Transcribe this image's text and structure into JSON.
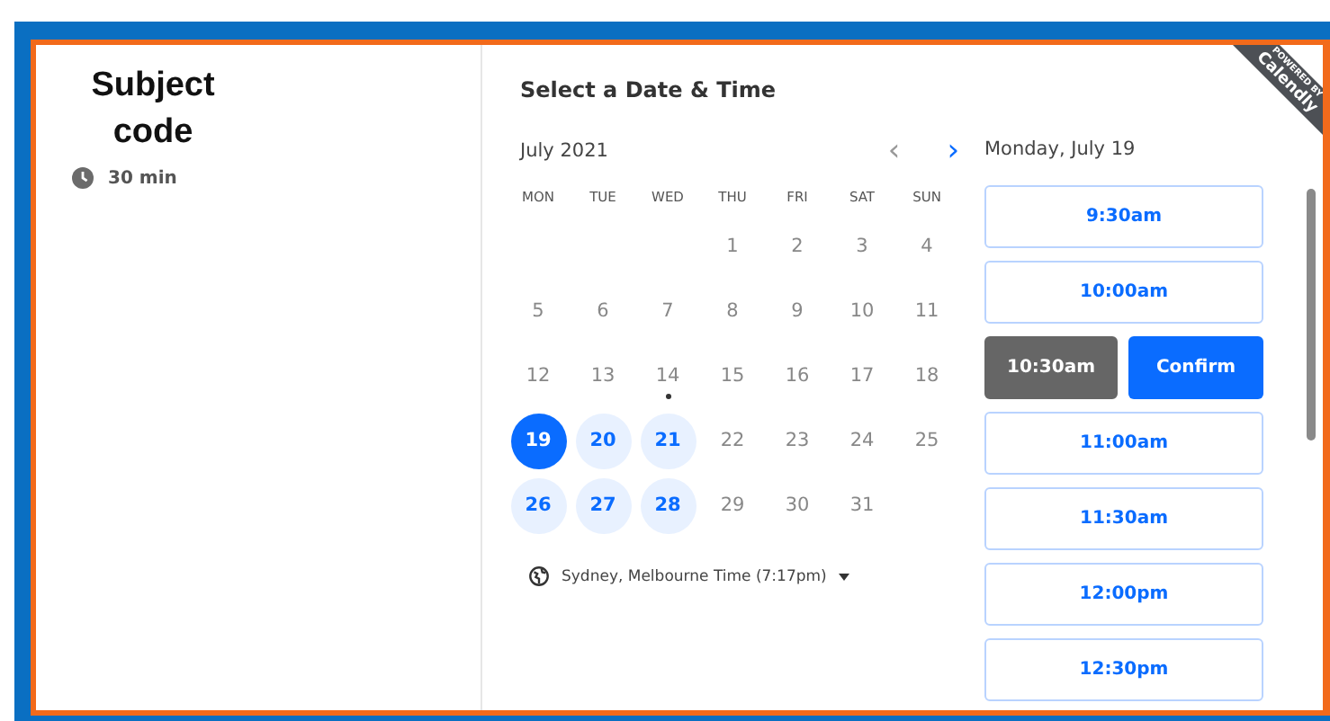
{
  "event": {
    "title": "Subject code",
    "duration": "30 min"
  },
  "ribbon": {
    "top": "POWERED BY",
    "brand": "Calendly"
  },
  "heading": "Select a Date & Time",
  "calendar": {
    "month": "July 2021",
    "prev": "‹",
    "next": "›",
    "weekdays": [
      "MON",
      "TUE",
      "WED",
      "THU",
      "FRI",
      "SAT",
      "SUN"
    ],
    "days": [
      {
        "label": "1",
        "available": false,
        "selected": false,
        "today": false
      },
      {
        "label": "2",
        "available": false,
        "selected": false,
        "today": false
      },
      {
        "label": "3",
        "available": false,
        "selected": false,
        "today": false
      },
      {
        "label": "4",
        "available": false,
        "selected": false,
        "today": false
      },
      {
        "label": "5",
        "available": false,
        "selected": false,
        "today": false
      },
      {
        "label": "6",
        "available": false,
        "selected": false,
        "today": false
      },
      {
        "label": "7",
        "available": false,
        "selected": false,
        "today": false
      },
      {
        "label": "8",
        "available": false,
        "selected": false,
        "today": false
      },
      {
        "label": "9",
        "available": false,
        "selected": false,
        "today": false
      },
      {
        "label": "10",
        "available": false,
        "selected": false,
        "today": false
      },
      {
        "label": "11",
        "available": false,
        "selected": false,
        "today": false
      },
      {
        "label": "12",
        "available": false,
        "selected": false,
        "today": false
      },
      {
        "label": "13",
        "available": false,
        "selected": false,
        "today": false
      },
      {
        "label": "14",
        "available": false,
        "selected": false,
        "today": true
      },
      {
        "label": "15",
        "available": false,
        "selected": false,
        "today": false
      },
      {
        "label": "16",
        "available": false,
        "selected": false,
        "today": false
      },
      {
        "label": "17",
        "available": false,
        "selected": false,
        "today": false
      },
      {
        "label": "18",
        "available": false,
        "selected": false,
        "today": false
      },
      {
        "label": "19",
        "available": true,
        "selected": true,
        "today": false
      },
      {
        "label": "20",
        "available": true,
        "selected": false,
        "today": false
      },
      {
        "label": "21",
        "available": true,
        "selected": false,
        "today": false
      },
      {
        "label": "22",
        "available": false,
        "selected": false,
        "today": false
      },
      {
        "label": "23",
        "available": false,
        "selected": false,
        "today": false
      },
      {
        "label": "24",
        "available": false,
        "selected": false,
        "today": false
      },
      {
        "label": "25",
        "available": false,
        "selected": false,
        "today": false
      },
      {
        "label": "26",
        "available": true,
        "selected": false,
        "today": false
      },
      {
        "label": "27",
        "available": true,
        "selected": false,
        "today": false
      },
      {
        "label": "28",
        "available": true,
        "selected": false,
        "today": false
      },
      {
        "label": "29",
        "available": false,
        "selected": false,
        "today": false
      },
      {
        "label": "30",
        "available": false,
        "selected": false,
        "today": false
      },
      {
        "label": "31",
        "available": false,
        "selected": false,
        "today": false
      }
    ],
    "timezone": "Sydney, Melbourne Time (7:17pm)"
  },
  "times": {
    "date": "Monday, July 19",
    "confirm": "Confirm",
    "slots": [
      {
        "label": "9:30am",
        "selected": false
      },
      {
        "label": "10:00am",
        "selected": false
      },
      {
        "label": "10:30am",
        "selected": true
      },
      {
        "label": "11:00am",
        "selected": false
      },
      {
        "label": "11:30am",
        "selected": false
      },
      {
        "label": "12:00pm",
        "selected": false
      },
      {
        "label": "12:30pm",
        "selected": false
      }
    ]
  }
}
